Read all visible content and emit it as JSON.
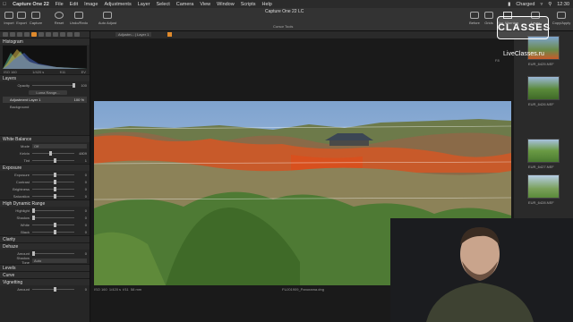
{
  "menubar": {
    "app_name": "Capture One 22",
    "items": [
      "File",
      "Edit",
      "Image",
      "Adjustments",
      "Layer",
      "Select",
      "Camera",
      "View",
      "Window",
      "Scripts",
      "Help"
    ],
    "status": "Charged",
    "time": "12:30"
  },
  "window": {
    "title": "Capture One 22 LC"
  },
  "toolbar": {
    "left_items": [
      "Import",
      "Export",
      "Capture"
    ],
    "history_items": [
      "Reset",
      "Undo/Redo"
    ],
    "auto_adjust": "Auto Adjust",
    "cursor_tools_label": "Cursor Tools",
    "cursor_values": [
      "85",
      "85",
      "85",
      "87"
    ],
    "right_items": [
      "Before",
      "Grids",
      "Exp. Warning",
      "Layer",
      "Copy/Apply"
    ]
  },
  "viewer_bar": {
    "layer_select": "Adjustm... | Layer 1"
  },
  "left_panel": {
    "histogram_title": "Histogram",
    "histogram_meta": [
      "ISO 160",
      "1/420 s",
      "f/11",
      "EV"
    ],
    "layers_title": "Layers",
    "opacity_label": "Opacity",
    "opacity_value": "100",
    "luma_range_label": "Luma Range...",
    "layer_name": "Adjustment Layer 1",
    "layer_opacity": "100 %",
    "background_label": "Background",
    "white_balance_title": "White Balance",
    "wb_rows": [
      {
        "label": "Mode",
        "value": "Off"
      },
      {
        "label": "Kelvin",
        "value": "4809"
      },
      {
        "label": "Tint",
        "value": "1"
      }
    ],
    "exposure_title": "Exposure",
    "exposure_rows": [
      "Exposure",
      "Contrast",
      "Brightness",
      "Saturation"
    ],
    "exposure_values": [
      "0",
      "0",
      "0",
      "0"
    ],
    "hdr_title": "High Dynamic Range",
    "hdr_rows": [
      "Highlight",
      "Shadow",
      "White",
      "Black"
    ],
    "hdr_values": [
      "0",
      "0",
      "0",
      "0"
    ],
    "clarity_title": "Clarity",
    "dehaze_title": "Dehaze",
    "dehaze_rows": [
      {
        "label": "Amount",
        "value": "0"
      },
      {
        "label": "Shadow Tone",
        "value": "Auto"
      }
    ],
    "levels_title": "Levels",
    "curve_title": "Curve",
    "vignetting_title": "Vignetting",
    "vignetting_amount_label": "Amount",
    "vignetting_amount_value": "0"
  },
  "photo_meta": {
    "iso": "ISO 160",
    "shutter": "1/420 s",
    "aperture": "f/11",
    "focal": "58 mm",
    "filename": "FUJ01909_Panorama.dng",
    "f_label": "F8"
  },
  "thumbnails": [
    "EUR_6425.NEF",
    "EUR_6426.NEF",
    "EUR_6427.NEF",
    "EUR_6428.NEF"
  ],
  "watermark": {
    "logo": "CLASSES",
    "site": "LiveClasses.ru"
  },
  "colors": {
    "accent": "#e08a2c"
  }
}
